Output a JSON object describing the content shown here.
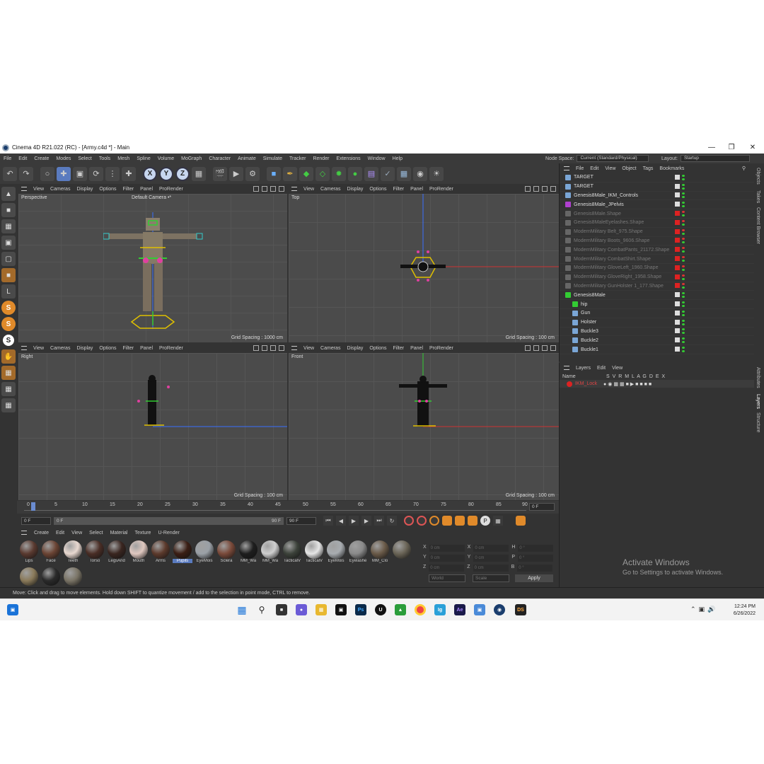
{
  "window": {
    "title": "Cinema 4D R21.022 (RC) - [Army.c4d *] - Main",
    "controls": [
      "—",
      "❐",
      "✕"
    ]
  },
  "menubar": {
    "items": [
      "File",
      "Edit",
      "Create",
      "Modes",
      "Select",
      "Tools",
      "Mesh",
      "Spline",
      "Volume",
      "MoGraph",
      "Character",
      "Animate",
      "Simulate",
      "Tracker",
      "Render",
      "Extensions",
      "Window",
      "Help"
    ],
    "node_space_label": "Node Space:",
    "node_space_value": "Current (Standard/Physical)",
    "layout_label": "Layout:",
    "layout_value": "Startup"
  },
  "toolbar": {
    "axis_x": "X",
    "axis_y": "Y",
    "axis_z": "Z"
  },
  "lefttools": {
    "s1": "S",
    "s2": "S",
    "s3": "S"
  },
  "viewports": [
    {
      "menu": [
        "View",
        "Cameras",
        "Display",
        "Options",
        "Filter",
        "Panel",
        "ProRender"
      ],
      "label": "Perspective",
      "camera": "Default Camera •*",
      "grid": "Grid Spacing : 1000 cm"
    },
    {
      "menu": [
        "View",
        "Cameras",
        "Display",
        "Options",
        "Filter",
        "Panel",
        "ProRender"
      ],
      "label": "Top",
      "camera": "",
      "grid": "Grid Spacing : 100 cm"
    },
    {
      "menu": [
        "View",
        "Cameras",
        "Display",
        "Options",
        "Filter",
        "Panel",
        "ProRender"
      ],
      "label": "Right",
      "camera": "",
      "grid": "Grid Spacing : 100 cm"
    },
    {
      "menu": [
        "View",
        "Cameras",
        "Display",
        "Options",
        "Filter",
        "Panel",
        "ProRender"
      ],
      "label": "Front",
      "camera": "",
      "grid": "Grid Spacing : 100 cm"
    }
  ],
  "timeline": {
    "ticks": [
      "0",
      "5",
      "10",
      "15",
      "20",
      "25",
      "30",
      "35",
      "40",
      "45",
      "50",
      "55",
      "60",
      "65",
      "70",
      "75",
      "80",
      "85",
      "90"
    ],
    "current_frame_right": "0 F",
    "start_frame": "0 F",
    "slider_left": "0 F",
    "slider_right": "90 F",
    "end_frame": "90 F"
  },
  "materials": {
    "menu": [
      "Create",
      "Edit",
      "View",
      "Select",
      "Material",
      "Texture",
      "U-Render"
    ],
    "items": [
      {
        "name": "Lips",
        "color": "#5a3a30"
      },
      {
        "name": "Face",
        "color": "#6b4434"
      },
      {
        "name": "Teeth",
        "color": "#e8d8d0"
      },
      {
        "name": "Torso",
        "color": "#4a2e26"
      },
      {
        "name": "LegsAnd",
        "color": "#3a2620"
      },
      {
        "name": "Mouth",
        "color": "#e0c8c0"
      },
      {
        "name": "Arms",
        "color": "#5c3a2c"
      },
      {
        "name": "Pupils",
        "color": "#3a1e14"
      },
      {
        "name": "EyeMois",
        "color": "#9aa0a6"
      },
      {
        "name": "Sclera",
        "color": "#7a4a3a"
      },
      {
        "name": "MM_Wa",
        "color": "#1e1e1e"
      },
      {
        "name": "MM_Wa",
        "color": "#cfcfcf"
      },
      {
        "name": "TacticalV",
        "color": "#3c423a"
      },
      {
        "name": "TacticalV",
        "color": "#e6e6e6"
      },
      {
        "name": "EyeMois",
        "color": "#a8acb0"
      },
      {
        "name": "Eyelashe",
        "color": "#8a8a8a"
      },
      {
        "name": "MM_Clo",
        "color": "#6a5a48"
      },
      {
        "name": "",
        "color": "#6a6456"
      },
      {
        "name": "",
        "color": "#8a7a5a"
      },
      {
        "name": "",
        "color": "#2a2a2a"
      },
      {
        "name": "",
        "color": "#7a7466"
      }
    ]
  },
  "coords": {
    "labels": [
      "X",
      "Y",
      "Z",
      "X",
      "Y",
      "Z",
      "H",
      "P",
      "B"
    ],
    "values": [
      "0 cm",
      "0 cm",
      "0 cm",
      "0 cm",
      "0 cm",
      "0 cm",
      "0 °",
      "0 °",
      "0 °"
    ],
    "world": "World",
    "scale": "Scale",
    "apply": "Apply"
  },
  "objmgr": {
    "menu": [
      "File",
      "Edit",
      "View",
      "Object",
      "Tags",
      "Bookmarks"
    ],
    "rows": [
      {
        "name": "TARGET",
        "dim": false
      },
      {
        "name": "TARGET",
        "dim": false
      },
      {
        "name": "Genesis8Male_IKM_Controls",
        "dim": false
      },
      {
        "name": "Genesis8Male_JPelvis",
        "dim": false
      },
      {
        "name": "Genesis8Male.Shape",
        "dim": true
      },
      {
        "name": "Genesis8MaleEyelashes.Shape",
        "dim": true
      },
      {
        "name": "ModernMilitary Belt_975.Shape",
        "dim": true
      },
      {
        "name": "ModernMilitary Boots_9606.Shape",
        "dim": true
      },
      {
        "name": "ModernMilitary CombatPants_21172.Shape",
        "dim": true
      },
      {
        "name": "ModernMilitary CombatShirt.Shape",
        "dim": true
      },
      {
        "name": "ModernMilitary GloveLeft_1960.Shape",
        "dim": true
      },
      {
        "name": "ModernMilitary GloveRight_1958.Shape",
        "dim": true
      },
      {
        "name": "ModernMilitary GunHolster 1_177.Shape",
        "dim": true
      },
      {
        "name": "Genesis8Male",
        "dim": false
      },
      {
        "name": "hip",
        "dim": false
      },
      {
        "name": "Gun",
        "dim": false
      },
      {
        "name": "Holster",
        "dim": false
      },
      {
        "name": "Buckle3",
        "dim": false
      },
      {
        "name": "Buckle2",
        "dim": false
      },
      {
        "name": "Buckle1",
        "dim": false
      }
    ]
  },
  "layers": {
    "menu": [
      "Layers",
      "Edit",
      "View"
    ],
    "header_name": "Name",
    "header_cols": "S V R M L A G D E X",
    "row_name": "IKM_Lock"
  },
  "sidetabs": [
    "Objects",
    "Takes",
    "Content Browser",
    "Attributes",
    "Layers",
    "Structure"
  ],
  "status": "Move: Click and drag to move elements. Hold down SHIFT to quantize movement / add to the selection in point mode, CTRL to remove.",
  "activate": {
    "line1": "Activate Windows",
    "line2": "Go to Settings to activate Windows."
  },
  "taskbar": {
    "apps": [
      "Ps",
      "Ae",
      "DS",
      "Ig"
    ],
    "time": "12:24 PM",
    "date": "6/26/2022"
  }
}
